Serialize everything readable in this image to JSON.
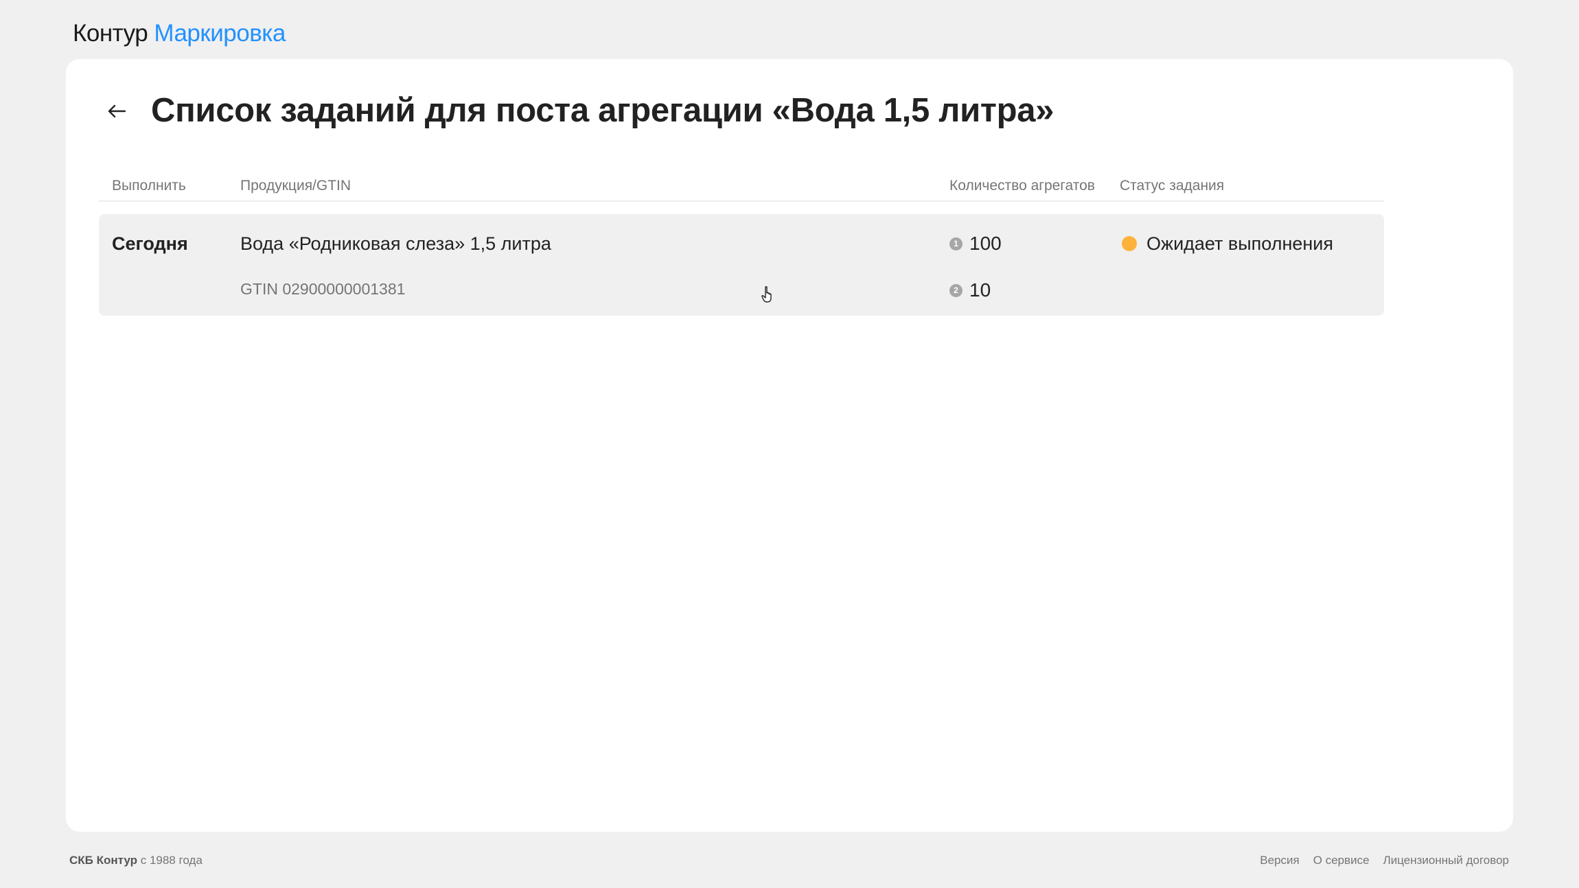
{
  "header": {
    "logo_brand": "Контур",
    "logo_product": "Маркировка"
  },
  "page": {
    "title": "Список заданий для поста агрегации «Вода 1,5 литра»",
    "back_icon": "arrow-left-icon"
  },
  "table": {
    "columns": {
      "execute": "Выполнить",
      "product": "Продукция/GTIN",
      "aggregates": "Количество агрегатов",
      "status": "Статус задания"
    },
    "rows": [
      {
        "execute": "Сегодня",
        "product_name": "Вода «Родниковая слеза» 1,5 литра",
        "gtin": "GTIN 02900000001381",
        "levels": [
          {
            "badge": "1",
            "count": "100"
          },
          {
            "badge": "2",
            "count": "10"
          }
        ],
        "status": "Ожидает выполнения",
        "status_color": "#fdb23c"
      }
    ]
  },
  "footer": {
    "company": "СКБ Контур",
    "since": " с 1988 года",
    "links": [
      "Версия",
      "О сервисе",
      "Лицензионный договор"
    ]
  },
  "colors": {
    "accent": "#2291ff",
    "background": "#f0f0f0",
    "row_background": "#f0f0f0"
  }
}
